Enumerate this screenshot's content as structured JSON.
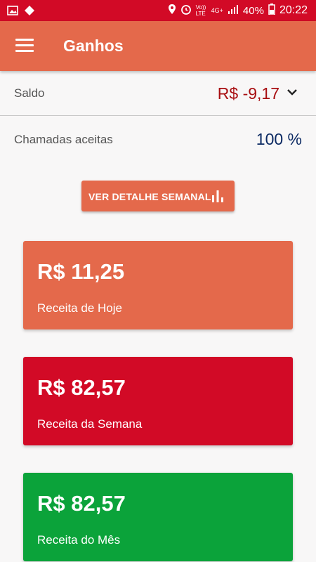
{
  "status_bar": {
    "network": "4G+",
    "volte": "Vo)) LTE",
    "battery": "40%",
    "time": "20:22"
  },
  "app_bar": {
    "title": "Ganhos"
  },
  "saldo": {
    "label": "Saldo",
    "value": "R$ -9,17"
  },
  "chamadas": {
    "label": "Chamadas aceitas",
    "value": "100 %"
  },
  "detail_button": {
    "label": "VER DETALHE SEMANAL"
  },
  "cards": [
    {
      "amount": "R$ 11,25",
      "caption": "Receita de Hoje",
      "color": "#e4694b"
    },
    {
      "amount": "R$ 82,57",
      "caption": "Receita da Semana",
      "color": "#d20a26"
    },
    {
      "amount": "R$ 82,57",
      "caption": "Receita do Mês",
      "color": "#0ba33a"
    }
  ],
  "colors": {
    "status_bar": "#d20a26",
    "app_bar": "#e4694b",
    "saldo_value": "#a80f12",
    "chamadas_value": "#0c2a63"
  }
}
